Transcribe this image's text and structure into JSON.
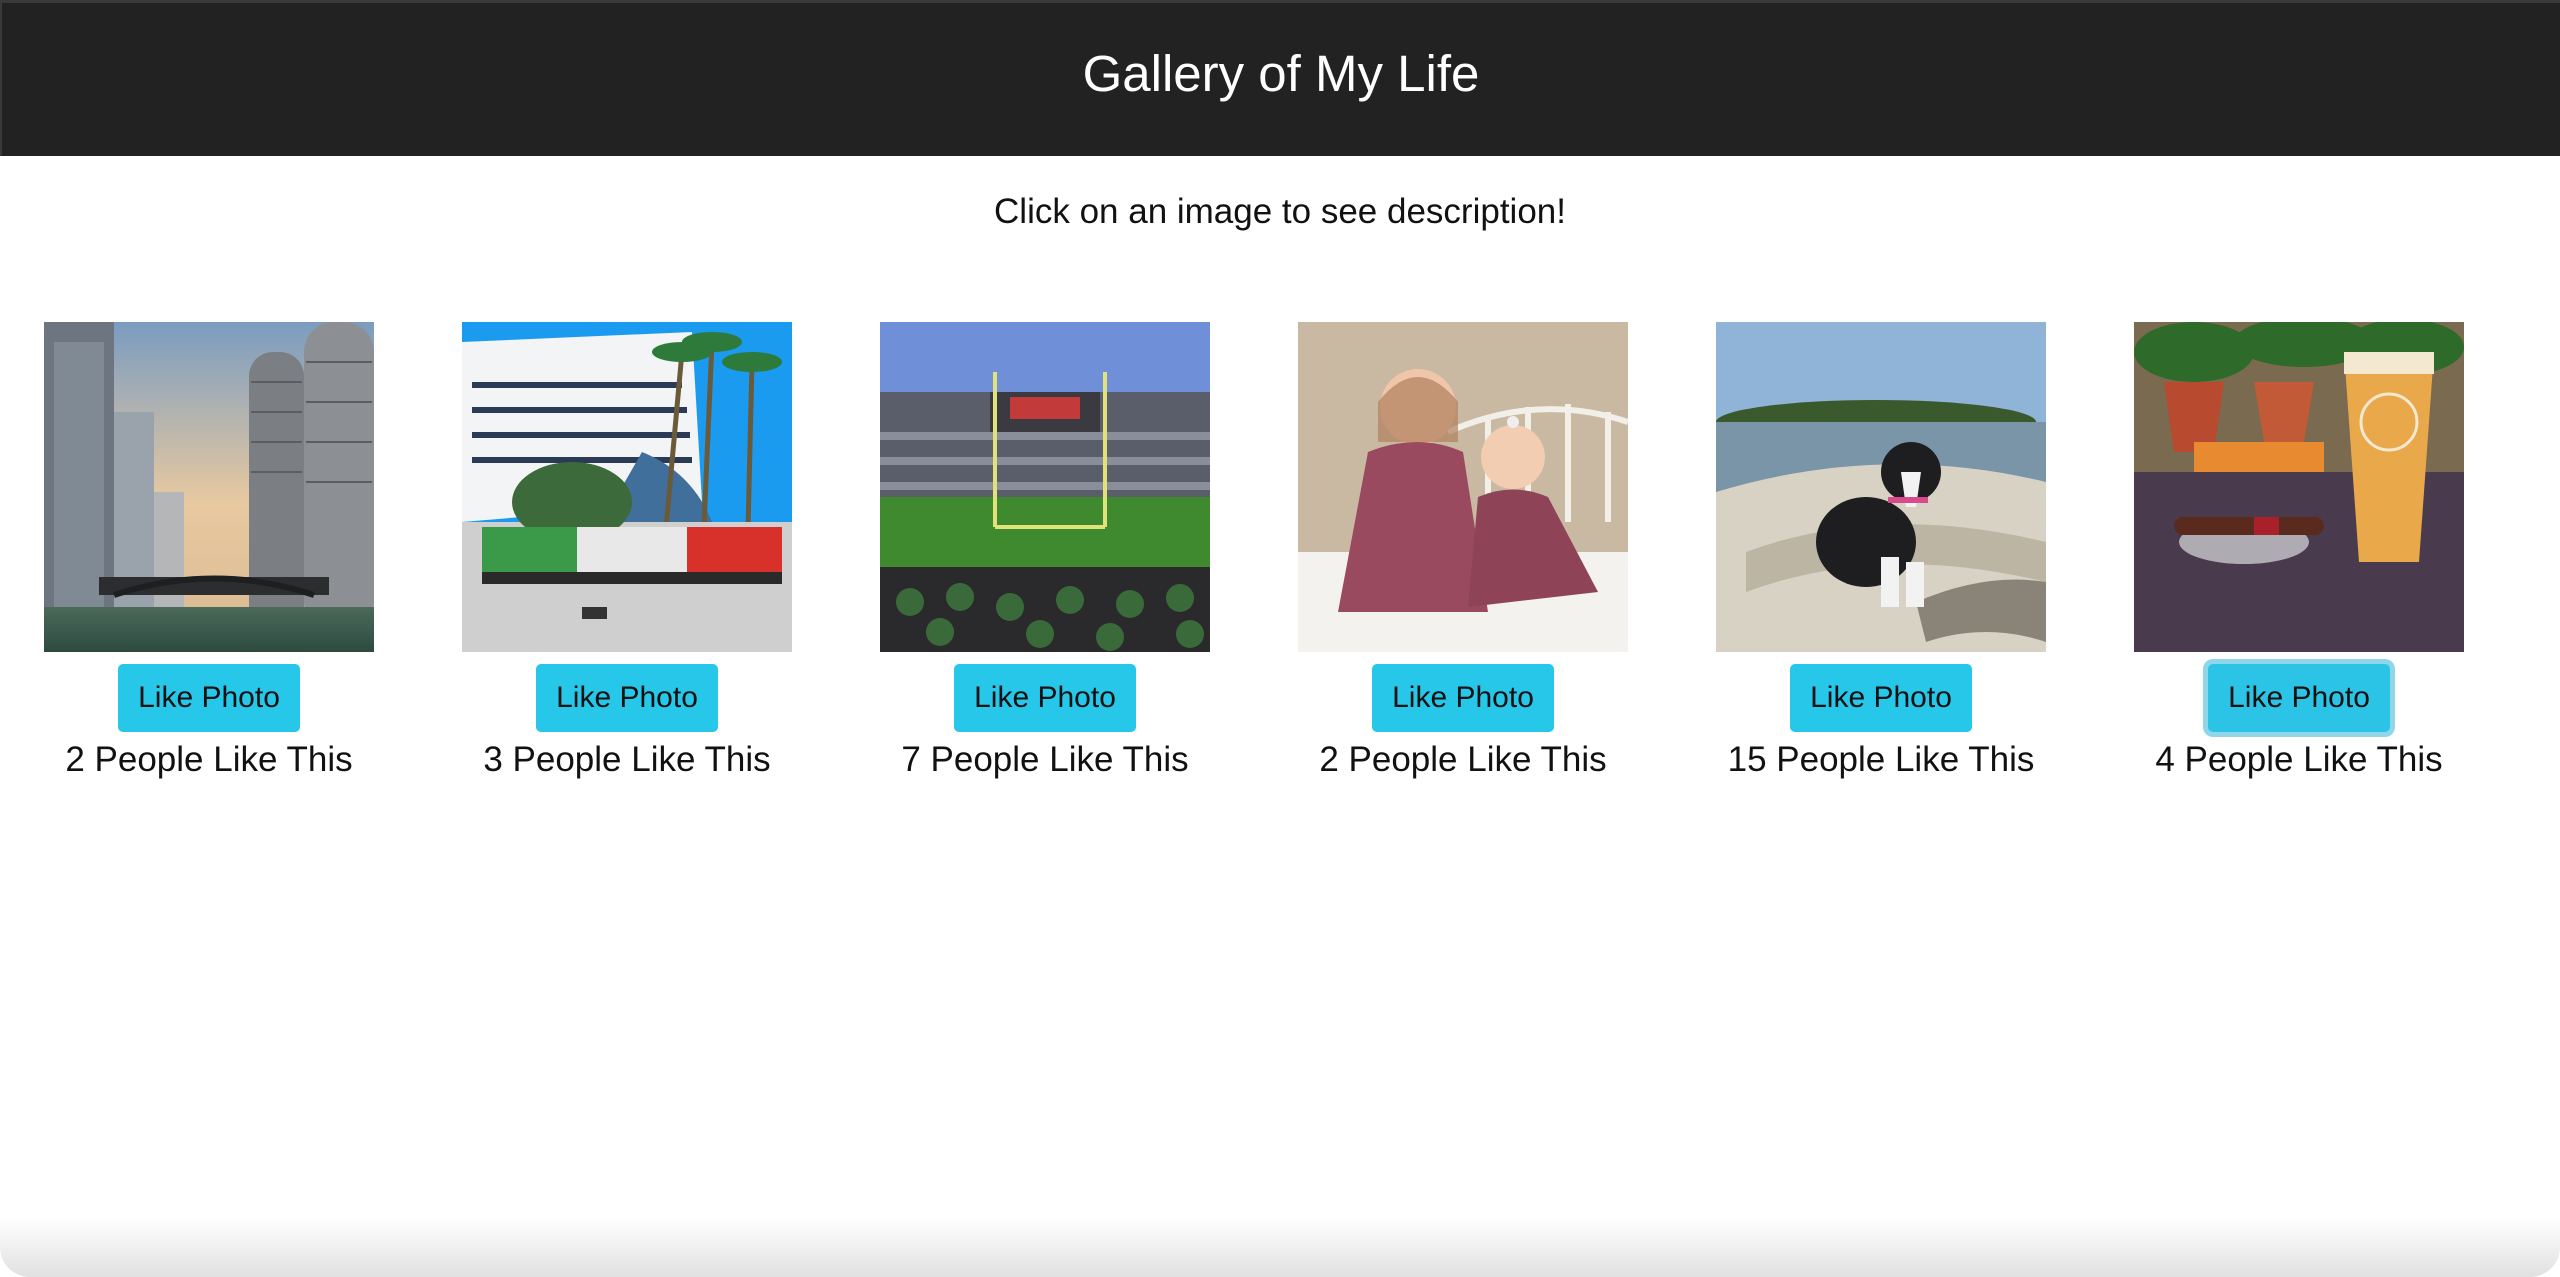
{
  "header": {
    "title": "Gallery of My Life"
  },
  "subtitle": "Click on an image to see description!",
  "photos": [
    {
      "subject": "chicago-river-skyline",
      "button_label": "Like Photo",
      "likes_text": "2 People Like This"
    },
    {
      "subject": "cruise-ship-ensenada-sign",
      "button_label": "Like Photo",
      "likes_text": "3 People Like This"
    },
    {
      "subject": "football-stadium-goalpost",
      "button_label": "Like Photo",
      "likes_text": "7 People Like This"
    },
    {
      "subject": "two-girls-on-bed",
      "button_label": "Like Photo",
      "likes_text": "2 People Like This"
    },
    {
      "subject": "dog-on-boat",
      "button_label": "Like Photo",
      "likes_text": "15 People Like This"
    },
    {
      "subject": "beer-and-cigar",
      "button_label": "Like Photo",
      "likes_text": "4 People Like This"
    }
  ],
  "colors": {
    "header_bg": "#222222",
    "button_bg": "#26c7e8",
    "focus_ring": "#8fd6e8"
  }
}
